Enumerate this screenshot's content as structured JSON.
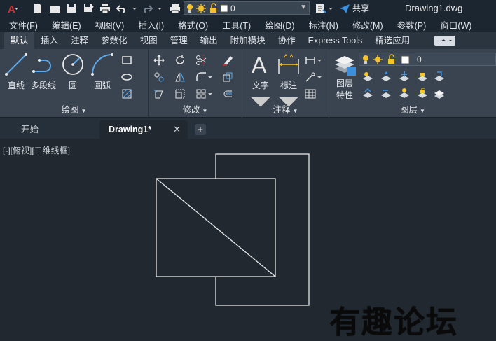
{
  "app": {
    "logo_text": "A",
    "title": "Drawing1.dwg"
  },
  "qat": {
    "layer_value": "0",
    "share_label": "共享"
  },
  "menu": [
    "文件(F)",
    "编辑(E)",
    "视图(V)",
    "插入(I)",
    "格式(O)",
    "工具(T)",
    "绘图(D)",
    "标注(N)",
    "修改(M)",
    "参数(P)",
    "窗口(W)"
  ],
  "ribbon_tabs": [
    "默认",
    "插入",
    "注释",
    "参数化",
    "视图",
    "管理",
    "输出",
    "附加模块",
    "协作",
    "Express Tools",
    "精选应用"
  ],
  "ribbon": {
    "draw": {
      "title": "绘图",
      "line": "直线",
      "polyline": "多段线",
      "circle": "圆",
      "arc": "圆弧"
    },
    "modify": {
      "title": "修改"
    },
    "annotation": {
      "title": "注释",
      "text": "文字",
      "dimension": "标注"
    },
    "layers": {
      "title": "图层",
      "properties_line1": "图层",
      "properties_line2": "特性",
      "layer_value": "0"
    }
  },
  "file_tabs": {
    "start": "开始",
    "drawing": "Drawing1*",
    "close": "✕",
    "add": "+"
  },
  "canvas": {
    "viewport_label": "[-][俯视][二维线框]",
    "watermark": "有趣论坛"
  },
  "colors": {
    "accent_red": "#d32c2c",
    "bulb_yellow": "#f4c430",
    "share_blue": "#3b8fdc"
  }
}
